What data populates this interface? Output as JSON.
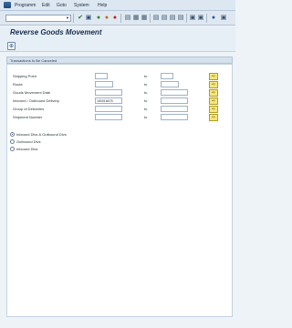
{
  "menu": {
    "items": [
      "Programm",
      "Edit",
      "Goto",
      "System",
      "Help"
    ]
  },
  "toolbar": {
    "command_field_value": "",
    "icons": [
      "enter-icon",
      "save-icon",
      "back-icon",
      "exit-icon",
      "cancel-icon",
      "print-icon",
      "find-icon",
      "find-next-icon",
      "first-page-icon",
      "prev-page-icon",
      "next-page-icon",
      "last-page-icon",
      "new-session-icon",
      "shortcut-icon",
      "help-icon",
      "customize-icon"
    ]
  },
  "page": {
    "title": "Reverse Goods Movement"
  },
  "group": {
    "title": "Transactions to Be Canceled"
  },
  "fields": [
    {
      "label": "Shipping Point",
      "from": "",
      "to_label": "to",
      "to": ""
    },
    {
      "label": "Route",
      "from": "",
      "to_label": "to",
      "to": ""
    },
    {
      "label": "Goods Movement Date",
      "from": "",
      "to_label": "to",
      "to": ""
    },
    {
      "label": "Inbound / Outbound Delivery",
      "from": "180016678",
      "to_label": "to",
      "to": ""
    },
    {
      "label": "Group of Deliveries",
      "from": "",
      "to_label": "to",
      "to": ""
    },
    {
      "label": "Shipment Number",
      "from": "",
      "to_label": "to",
      "to": ""
    }
  ],
  "radios": {
    "options": [
      "Inbound Dlvs & Outbound Dlvs",
      "Outbound Dlvs",
      "Inbound Dlvs"
    ],
    "selected": "Inbound Dlvs & Outbound Dlvs"
  },
  "colors": {
    "background": "#eef3f8",
    "toolbar": "#dfe8f1",
    "group_title_bg": "#d5e1ed",
    "multiple_selection": "#f5e77a",
    "title_text": "#18304f"
  }
}
